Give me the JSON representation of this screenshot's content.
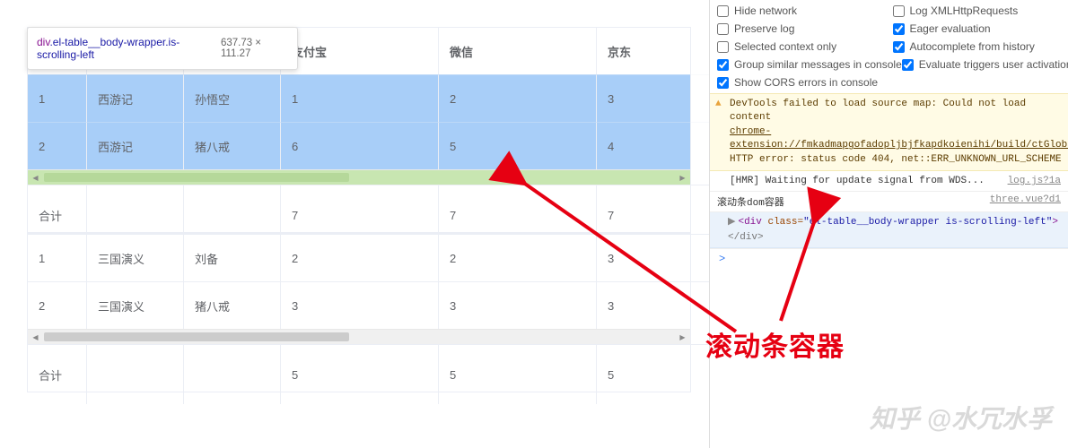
{
  "tooltip": {
    "tag": "div",
    "cls": ".el-table__body-wrapper.is-scrolling-left",
    "dim": "637.73 × 111.27"
  },
  "headers": {
    "c3": "支付宝",
    "c4": "微信",
    "c5": "京东"
  },
  "table1": {
    "rows": [
      {
        "n": "1",
        "book": "西游记",
        "name": "孙悟空",
        "c3": "1",
        "c4": "2",
        "c5": "3"
      },
      {
        "n": "2",
        "book": "西游记",
        "name": "猪八戒",
        "c3": "6",
        "c4": "5",
        "c5": "4"
      }
    ],
    "sum": {
      "label": "合计",
      "c3": "7",
      "c4": "7",
      "c5": "7"
    }
  },
  "table2": {
    "rows": [
      {
        "n": "1",
        "book": "三国演义",
        "name": "刘备",
        "c3": "2",
        "c4": "2",
        "c5": "3"
      },
      {
        "n": "2",
        "book": "三国演义",
        "name": "猪八戒",
        "c3": "3",
        "c4": "3",
        "c5": "3"
      }
    ],
    "sum": {
      "label": "合计",
      "c3": "5",
      "c4": "5",
      "c5": "5"
    }
  },
  "devtools": {
    "checks": [
      [
        "Hide network",
        "Log XMLHttpRequests"
      ],
      [
        "Preserve log",
        "Eager evaluation"
      ],
      [
        "Selected context only",
        "Autocomplete from history"
      ],
      [
        "Group similar messages in console",
        "Evaluate triggers user activation"
      ],
      [
        "Show CORS errors in console",
        ""
      ]
    ],
    "warn_line1": "DevTools failed to load source map: Could not load content",
    "warn_link": "chrome-extension://fmkadmapgofadopljbjfkapdkoienihi/build/ctGlobalHook.js.map",
    "warn_line2": ": HTTP error: status code 404, net::ERR_UNKNOWN_URL_SCHEME",
    "hmr": "[HMR] Waiting for update signal from WDS...",
    "hmr_src": "log.js?1a",
    "dom_title": "滚动条dom容器",
    "dom_src": "three.vue?d1",
    "div_open": "<div class=",
    "div_cls": "\"el-table__body-wrapper is-scrolling-left\"",
    "div_close": "</div>",
    "prompt": ">"
  },
  "callout": "滚动条容器",
  "watermark": "知乎 @水冗水孚"
}
